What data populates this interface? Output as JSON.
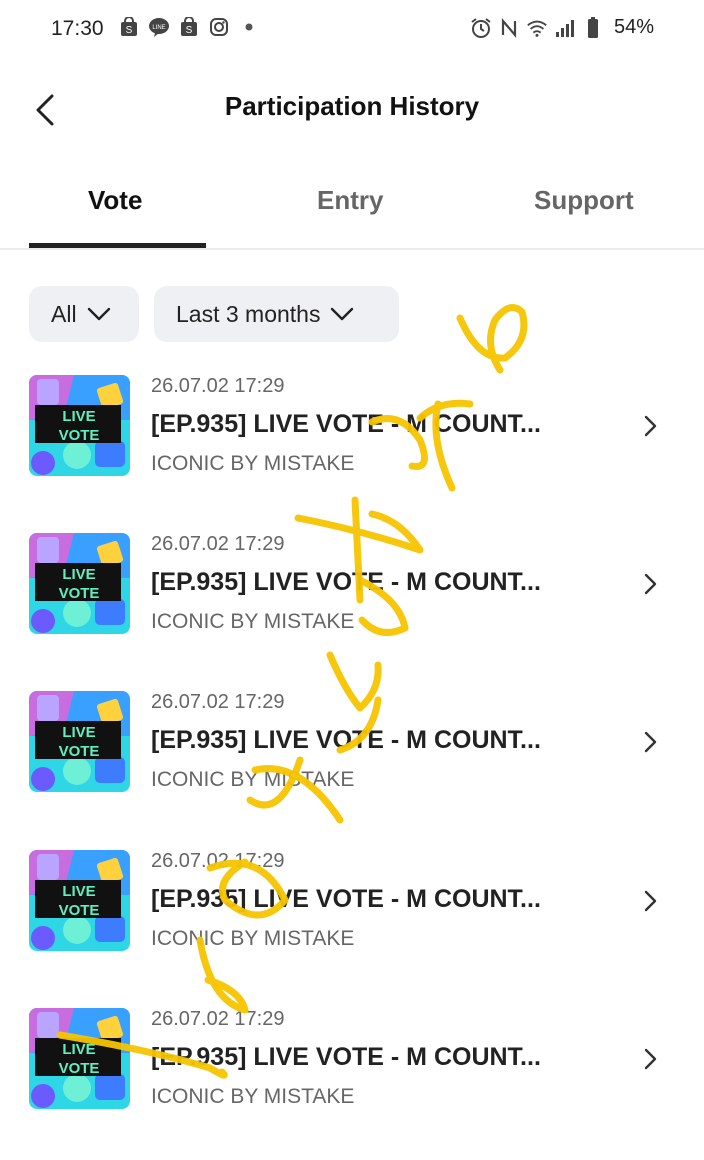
{
  "status_bar": {
    "time": "17:30",
    "left_icons": [
      "shopee-icon",
      "line-icon",
      "shopee-icon",
      "instagram-icon",
      "dot-icon"
    ],
    "right_icons": [
      "alarm-icon",
      "nfc-icon",
      "wifi-icon",
      "signal-icon",
      "battery-icon"
    ],
    "battery": "54%"
  },
  "header": {
    "back_icon": "back-arrow-icon",
    "title": "Participation History"
  },
  "tabs": [
    {
      "label": "Vote",
      "active": true
    },
    {
      "label": "Entry",
      "active": false
    },
    {
      "label": "Support",
      "active": false
    }
  ],
  "filters": {
    "type": "All",
    "period": "Last 3 months"
  },
  "items": [
    {
      "date": "26.07.02 17:29",
      "title": "[EP.935] LIVE VOTE - M COUNT...",
      "subtitle": "ICONIC BY MISTAKE",
      "thumb_text_1": "LIVE",
      "thumb_text_2": "VOTE"
    },
    {
      "date": "26.07.02 17:29",
      "title": "[EP.935] LIVE VOTE - M COUNT...",
      "subtitle": "ICONIC BY MISTAKE",
      "thumb_text_1": "LIVE",
      "thumb_text_2": "VOTE"
    },
    {
      "date": "26.07.02 17:29",
      "title": "[EP.935] LIVE VOTE - M COUNT...",
      "subtitle": "ICONIC BY MISTAKE",
      "thumb_text_1": "LIVE",
      "thumb_text_2": "VOTE"
    },
    {
      "date": "26.07.02 17:29",
      "title": "[EP.935] LIVE VOTE - M COUNT...",
      "subtitle": "ICONIC BY MISTAKE",
      "thumb_text_1": "LIVE",
      "thumb_text_2": "VOTE"
    },
    {
      "date": "26.07.02 17:29",
      "title": "[EP.935] LIVE VOTE - M COUNT...",
      "subtitle": "ICONIC BY MISTAKE",
      "thumb_text_1": "LIVE",
      "thumb_text_2": "VOTE"
    }
  ],
  "colors": {
    "active_tab": "#111111",
    "inactive_tab": "#666666",
    "filter_bg": "#eff0f3",
    "watermark": "#f6c500"
  }
}
